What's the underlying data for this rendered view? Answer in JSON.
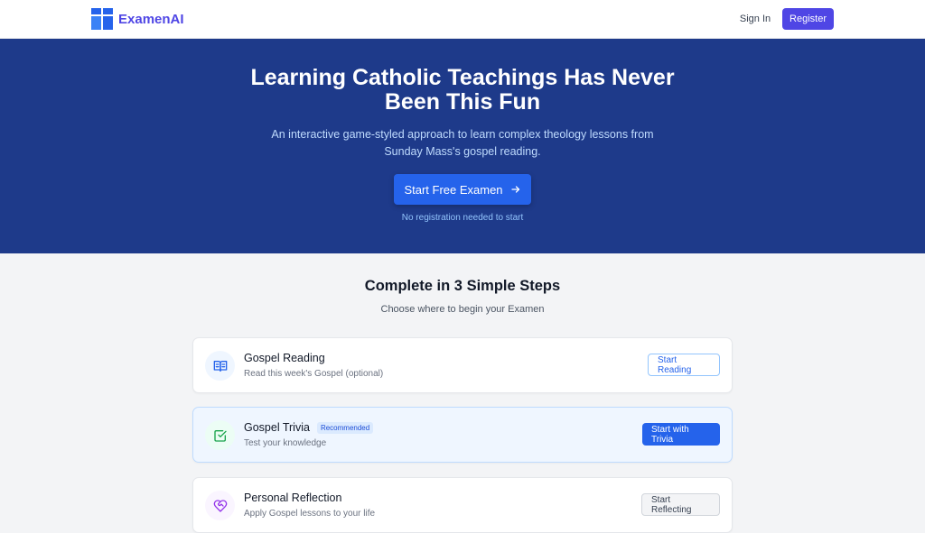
{
  "header": {
    "brand": "ExamenAI",
    "signin_label": "Sign In",
    "register_label": "Register"
  },
  "hero": {
    "title": "Learning Catholic Teachings Has Never Been This Fun",
    "subtitle": "An interactive game-styled approach to learn complex theology lessons from Sunday Mass's gospel reading.",
    "cta_label": "Start Free Examen",
    "note": "No registration needed to start"
  },
  "steps": {
    "title": "Complete in 3 Simple Steps",
    "subtitle": "Choose where to begin your Examen",
    "items": [
      {
        "title": "Gospel Reading",
        "description": "Read this week's Gospel (optional)",
        "button": "Start Reading",
        "icon": "book-open-icon"
      },
      {
        "title": "Gospel Trivia",
        "badge": "Recommended",
        "description": "Test your knowledge",
        "button": "Start with Trivia",
        "icon": "check-square-icon"
      },
      {
        "title": "Personal Reflection",
        "description": "Apply Gospel lessons to your life",
        "button": "Start Reflecting",
        "icon": "heart-handshake-icon"
      }
    ]
  },
  "colors": {
    "brand": "#4f46e5",
    "hero_bg": "#1e3a8a",
    "primary": "#2563eb"
  }
}
